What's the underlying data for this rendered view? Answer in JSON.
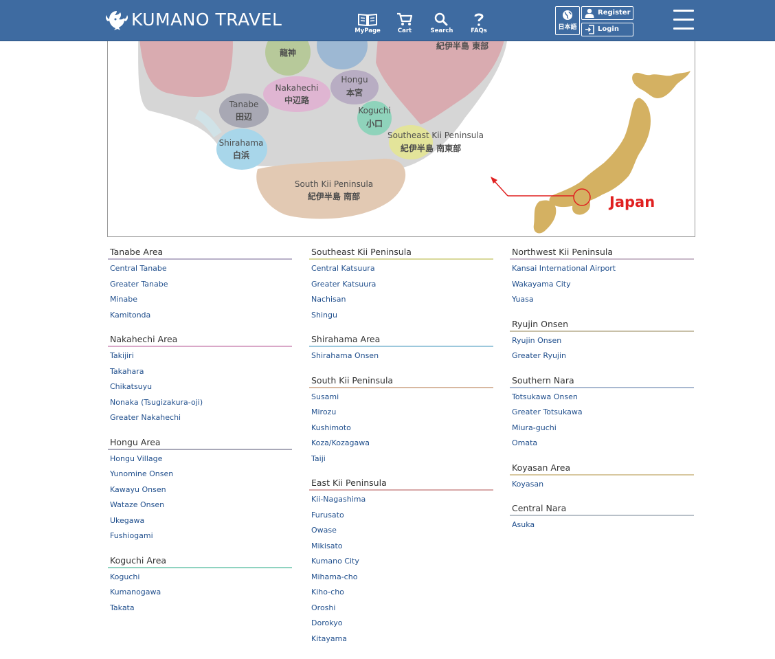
{
  "header": {
    "brand": "KUMANO TRAVEL",
    "nav": [
      {
        "label": "MyPage",
        "icon": "book-icon"
      },
      {
        "label": "Cart",
        "icon": "cart-icon"
      },
      {
        "label": "Search",
        "icon": "search-icon"
      },
      {
        "label": "FAQs",
        "icon": "question-icon"
      }
    ],
    "language_label": "日本語",
    "register_label": "Register",
    "login_label": "Login",
    "accent_color": "#3e6ba1"
  },
  "map": {
    "regions": [
      {
        "en": "",
        "ja": "龍神"
      },
      {
        "en": "",
        "ja": "紀伊半島 東部"
      },
      {
        "en": "Nakahechi",
        "ja": "中辺路"
      },
      {
        "en": "Hongu",
        "ja": "本宮"
      },
      {
        "en": "Tanabe",
        "ja": "田辺"
      },
      {
        "en": "Koguchi",
        "ja": "小口"
      },
      {
        "en": "Southeast Kii Peninsula",
        "ja": "紀伊半島 南東部"
      },
      {
        "en": "Shirahama",
        "ja": "白浜"
      },
      {
        "en": "South Kii Peninsula",
        "ja": "紀伊半島 南部"
      }
    ],
    "country_label": "Japan"
  },
  "columns": [
    [
      {
        "title": "Tanabe Area",
        "color": "#b8b0c8",
        "items": [
          "Central Tanabe",
          "Greater Tanabe",
          "Minabe",
          "Kamitonda"
        ]
      },
      {
        "title": "Nakahechi Area",
        "color": "#d9a8c8",
        "items": [
          "Takijiri",
          "Takahara",
          "Chikatsuyu",
          "Nonaka (Tsugizakura-oji)",
          "Greater Nakahechi"
        ]
      },
      {
        "title": "Hongu Area",
        "color": "#a8a8b8",
        "items": [
          "Hongu Village",
          "Yunomine Onsen",
          "Kawayu Onsen",
          "Wataze Onsen",
          "Ukegawa",
          "Fushiogami"
        ]
      },
      {
        "title": "Koguchi Area",
        "color": "#8fd3c0",
        "items": [
          "Koguchi",
          "Kumanogawa",
          "Takata"
        ]
      }
    ],
    [
      {
        "title": "Southeast Kii Peninsula",
        "color": "#d8d89a",
        "items": [
          "Central Katsuura",
          "Greater Katsuura",
          "Nachisan",
          "Shingu"
        ]
      },
      {
        "title": "Shirahama Area",
        "color": "#9cc8dc",
        "items": [
          "Shirahama Onsen"
        ]
      },
      {
        "title": "South Kii Peninsula",
        "color": "#d8b8a0",
        "items": [
          "Susami",
          "Mirozu",
          "Kushimoto",
          "Koza/Kozagawa",
          "Taiji"
        ]
      },
      {
        "title": "East Kii Peninsula",
        "color": "#d8a8a8",
        "items": [
          "Kii-Nagashima",
          "Furusato",
          "Owase",
          "Mikisato",
          "Kumano City",
          "Mihama-cho",
          "Kiho-cho",
          "Oroshi",
          "Dorokyo",
          "Kitayama"
        ]
      }
    ],
    [
      {
        "title": "Northwest Kii Peninsula",
        "color": "#c8b8c8",
        "items": [
          "Kansai International Airport",
          "Wakayama City",
          "Yuasa"
        ]
      },
      {
        "title": "Ryujin Onsen",
        "color": "#c8c0a8",
        "items": [
          "Ryujin Onsen",
          "Greater Ryujin"
        ]
      },
      {
        "title": "Southern Nara",
        "color": "#a8b8d0",
        "items": [
          "Totsukawa Onsen",
          "Greater Totsukawa",
          "Miura-guchi",
          "Omata"
        ]
      },
      {
        "title": "Koyasan Area",
        "color": "#d8c8a0",
        "items": [
          "Koyasan"
        ]
      },
      {
        "title": "Central Nara",
        "color": "#b8c0c8",
        "items": [
          "Asuka"
        ]
      }
    ]
  ]
}
